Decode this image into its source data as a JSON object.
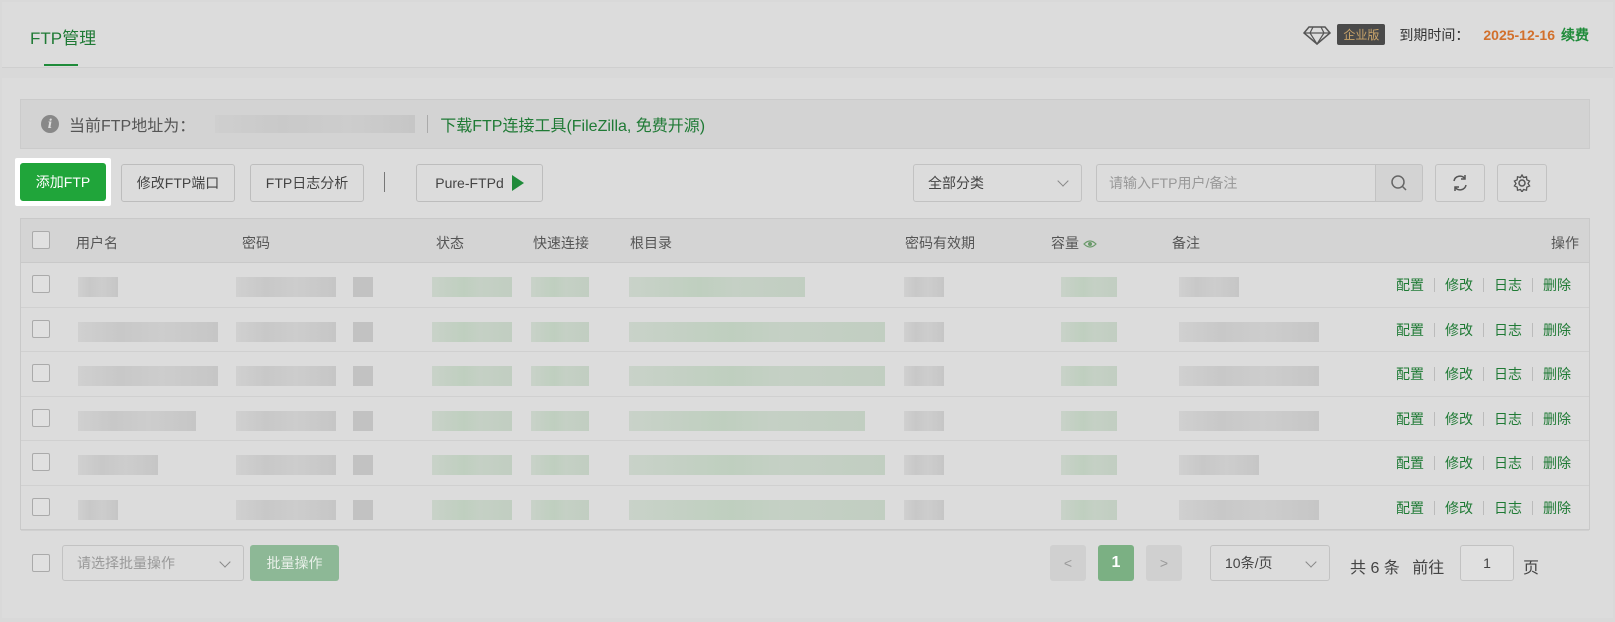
{
  "header": {
    "tab_title": "FTP管理",
    "edition_badge": "企业版",
    "expire_label": "到期时间：",
    "expire_date": "2025-12-16",
    "renew_label": "续费"
  },
  "notice": {
    "label": "当前FTP地址为：",
    "download_link": "下载FTP连接工具(FileZilla, 免费开源)"
  },
  "toolbar": {
    "add_ftp": "添加FTP",
    "change_port": "修改FTP端口",
    "log_analysis": "FTP日志分析",
    "service_name": "Pure-FTPd",
    "category_select": "全部分类",
    "search_placeholder": "请输入FTP用户/备注"
  },
  "table": {
    "columns": [
      "用户名",
      "密码",
      "状态",
      "快速连接",
      "根目录",
      "密码有效期",
      "容量",
      "备注",
      "操作"
    ],
    "row_actions": [
      "配置",
      "修改",
      "日志",
      "删除"
    ],
    "row_count": 6
  },
  "footer": {
    "batch_placeholder": "请选择批量操作",
    "batch_button": "批量操作",
    "prev": "<",
    "current_page": "1",
    "next": ">",
    "per_page": "10条/页",
    "total": "共 6 条",
    "goto_label": "前往",
    "goto_value": "1",
    "page_suffix": "页"
  },
  "colors": {
    "accent": "#20a53a",
    "expire_date": "#d2702c"
  }
}
